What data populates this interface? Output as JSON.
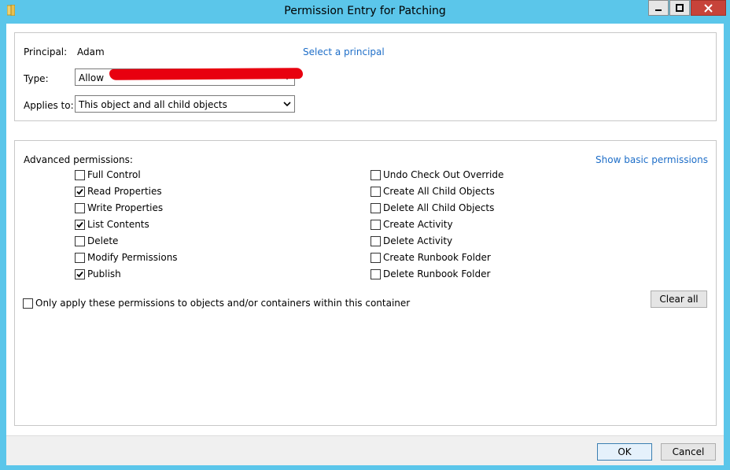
{
  "window": {
    "title": "Permission Entry for Patching",
    "controls": {
      "minimize": "minimize-icon",
      "maximize": "maximize-icon",
      "close": "close-icon"
    },
    "app_icon": "folder-icon"
  },
  "principal_section": {
    "principal_label": "Principal:",
    "principal_value": "Adam",
    "select_principal_link": "Select a principal",
    "type_label": "Type:",
    "type_value": "Allow",
    "applies_label": "Applies to:",
    "applies_value": "This object and all child objects"
  },
  "permissions": {
    "heading": "Advanced permissions:",
    "show_basic_link": "Show basic permissions",
    "left": [
      {
        "label": "Full Control",
        "checked": false
      },
      {
        "label": "Read Properties",
        "checked": true
      },
      {
        "label": "Write Properties",
        "checked": false
      },
      {
        "label": "List Contents",
        "checked": true
      },
      {
        "label": "Delete",
        "checked": false
      },
      {
        "label": "Modify Permissions",
        "checked": false
      },
      {
        "label": "Publish",
        "checked": true
      }
    ],
    "right": [
      {
        "label": "Undo Check Out Override",
        "checked": false
      },
      {
        "label": "Create All Child Objects",
        "checked": false
      },
      {
        "label": "Delete All Child Objects",
        "checked": false
      },
      {
        "label": "Create Activity",
        "checked": false
      },
      {
        "label": "Delete Activity",
        "checked": false
      },
      {
        "label": "Create Runbook Folder",
        "checked": false
      },
      {
        "label": "Delete Runbook Folder",
        "checked": false
      }
    ],
    "only_apply": {
      "label": "Only apply these permissions to objects and/or containers within this container",
      "checked": false
    },
    "clear_all": "Clear all"
  },
  "footer": {
    "ok": "OK",
    "cancel": "Cancel"
  },
  "colors": {
    "titlebar": "#5bc6ea",
    "close_button": "#c7433a",
    "link": "#1e6ec8",
    "redaction": "#e8000f"
  }
}
